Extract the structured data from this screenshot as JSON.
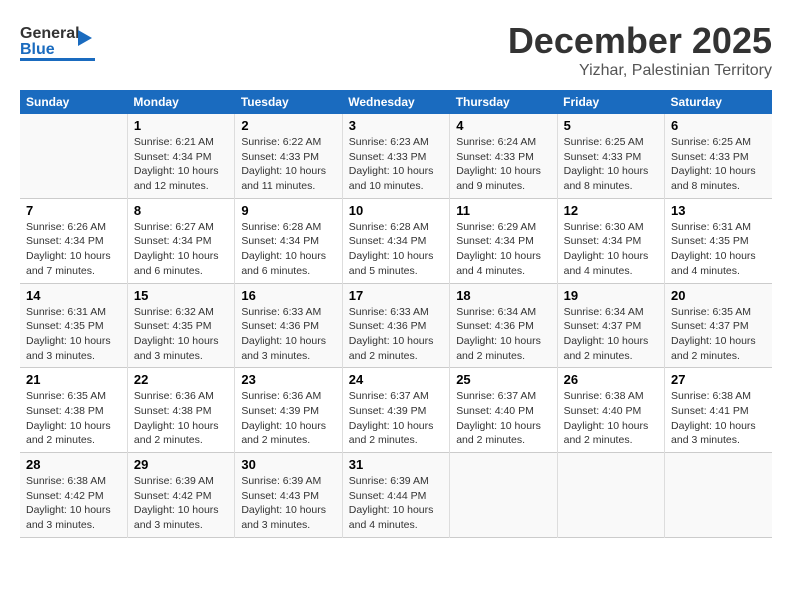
{
  "logo": {
    "general": "General",
    "blue": "Blue"
  },
  "title": "December 2025",
  "subtitle": "Yizhar, Palestinian Territory",
  "days_of_week": [
    "Sunday",
    "Monday",
    "Tuesday",
    "Wednesday",
    "Thursday",
    "Friday",
    "Saturday"
  ],
  "weeks": [
    [
      {
        "day": "",
        "info": ""
      },
      {
        "day": "1",
        "info": "Sunrise: 6:21 AM\nSunset: 4:34 PM\nDaylight: 10 hours\nand 12 minutes."
      },
      {
        "day": "2",
        "info": "Sunrise: 6:22 AM\nSunset: 4:33 PM\nDaylight: 10 hours\nand 11 minutes."
      },
      {
        "day": "3",
        "info": "Sunrise: 6:23 AM\nSunset: 4:33 PM\nDaylight: 10 hours\nand 10 minutes."
      },
      {
        "day": "4",
        "info": "Sunrise: 6:24 AM\nSunset: 4:33 PM\nDaylight: 10 hours\nand 9 minutes."
      },
      {
        "day": "5",
        "info": "Sunrise: 6:25 AM\nSunset: 4:33 PM\nDaylight: 10 hours\nand 8 minutes."
      },
      {
        "day": "6",
        "info": "Sunrise: 6:25 AM\nSunset: 4:33 PM\nDaylight: 10 hours\nand 8 minutes."
      }
    ],
    [
      {
        "day": "7",
        "info": "Sunrise: 6:26 AM\nSunset: 4:34 PM\nDaylight: 10 hours\nand 7 minutes."
      },
      {
        "day": "8",
        "info": "Sunrise: 6:27 AM\nSunset: 4:34 PM\nDaylight: 10 hours\nand 6 minutes."
      },
      {
        "day": "9",
        "info": "Sunrise: 6:28 AM\nSunset: 4:34 PM\nDaylight: 10 hours\nand 6 minutes."
      },
      {
        "day": "10",
        "info": "Sunrise: 6:28 AM\nSunset: 4:34 PM\nDaylight: 10 hours\nand 5 minutes."
      },
      {
        "day": "11",
        "info": "Sunrise: 6:29 AM\nSunset: 4:34 PM\nDaylight: 10 hours\nand 4 minutes."
      },
      {
        "day": "12",
        "info": "Sunrise: 6:30 AM\nSunset: 4:34 PM\nDaylight: 10 hours\nand 4 minutes."
      },
      {
        "day": "13",
        "info": "Sunrise: 6:31 AM\nSunset: 4:35 PM\nDaylight: 10 hours\nand 4 minutes."
      }
    ],
    [
      {
        "day": "14",
        "info": "Sunrise: 6:31 AM\nSunset: 4:35 PM\nDaylight: 10 hours\nand 3 minutes."
      },
      {
        "day": "15",
        "info": "Sunrise: 6:32 AM\nSunset: 4:35 PM\nDaylight: 10 hours\nand 3 minutes."
      },
      {
        "day": "16",
        "info": "Sunrise: 6:33 AM\nSunset: 4:36 PM\nDaylight: 10 hours\nand 3 minutes."
      },
      {
        "day": "17",
        "info": "Sunrise: 6:33 AM\nSunset: 4:36 PM\nDaylight: 10 hours\nand 2 minutes."
      },
      {
        "day": "18",
        "info": "Sunrise: 6:34 AM\nSunset: 4:36 PM\nDaylight: 10 hours\nand 2 minutes."
      },
      {
        "day": "19",
        "info": "Sunrise: 6:34 AM\nSunset: 4:37 PM\nDaylight: 10 hours\nand 2 minutes."
      },
      {
        "day": "20",
        "info": "Sunrise: 6:35 AM\nSunset: 4:37 PM\nDaylight: 10 hours\nand 2 minutes."
      }
    ],
    [
      {
        "day": "21",
        "info": "Sunrise: 6:35 AM\nSunset: 4:38 PM\nDaylight: 10 hours\nand 2 minutes."
      },
      {
        "day": "22",
        "info": "Sunrise: 6:36 AM\nSunset: 4:38 PM\nDaylight: 10 hours\nand 2 minutes."
      },
      {
        "day": "23",
        "info": "Sunrise: 6:36 AM\nSunset: 4:39 PM\nDaylight: 10 hours\nand 2 minutes."
      },
      {
        "day": "24",
        "info": "Sunrise: 6:37 AM\nSunset: 4:39 PM\nDaylight: 10 hours\nand 2 minutes."
      },
      {
        "day": "25",
        "info": "Sunrise: 6:37 AM\nSunset: 4:40 PM\nDaylight: 10 hours\nand 2 minutes."
      },
      {
        "day": "26",
        "info": "Sunrise: 6:38 AM\nSunset: 4:40 PM\nDaylight: 10 hours\nand 2 minutes."
      },
      {
        "day": "27",
        "info": "Sunrise: 6:38 AM\nSunset: 4:41 PM\nDaylight: 10 hours\nand 3 minutes."
      }
    ],
    [
      {
        "day": "28",
        "info": "Sunrise: 6:38 AM\nSunset: 4:42 PM\nDaylight: 10 hours\nand 3 minutes."
      },
      {
        "day": "29",
        "info": "Sunrise: 6:39 AM\nSunset: 4:42 PM\nDaylight: 10 hours\nand 3 minutes."
      },
      {
        "day": "30",
        "info": "Sunrise: 6:39 AM\nSunset: 4:43 PM\nDaylight: 10 hours\nand 3 minutes."
      },
      {
        "day": "31",
        "info": "Sunrise: 6:39 AM\nSunset: 4:44 PM\nDaylight: 10 hours\nand 4 minutes."
      },
      {
        "day": "",
        "info": ""
      },
      {
        "day": "",
        "info": ""
      },
      {
        "day": "",
        "info": ""
      }
    ]
  ]
}
